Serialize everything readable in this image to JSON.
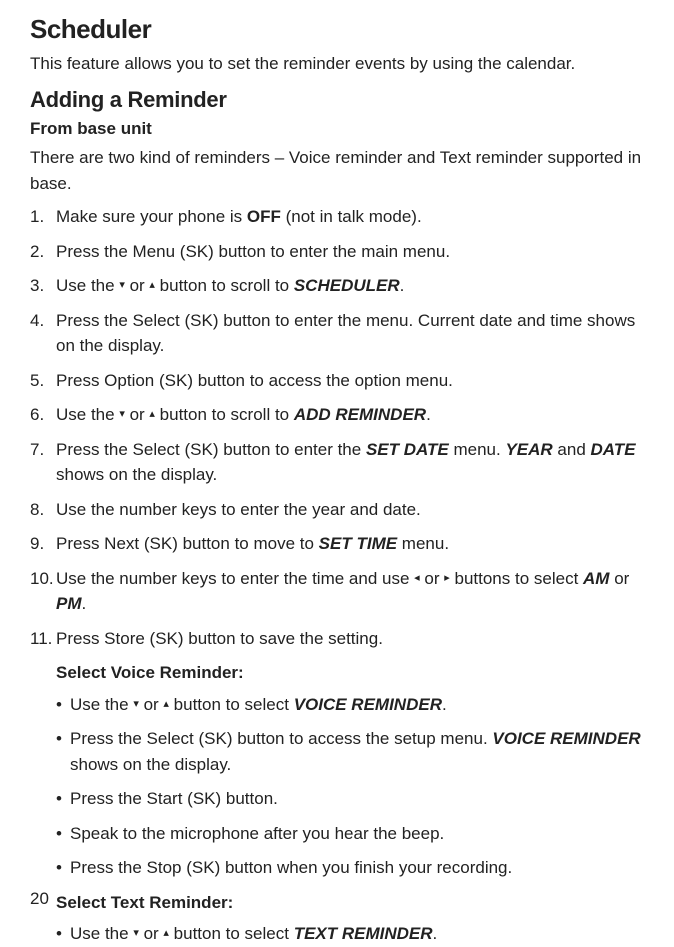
{
  "title": "Scheduler",
  "intro": "This feature allows you to set the reminder events by using the calendar.",
  "section_title": "Adding a Reminder",
  "sub_title": "From base unit",
  "para1": "There are two kind of reminders – Voice reminder and Text reminder supported in base.",
  "steps": {
    "s1_a": "Make sure your phone is ",
    "s1_off": "OFF",
    "s1_b": " (not in talk mode).",
    "s2": "Press the Menu (SK) button to enter the main menu.",
    "s3_a": "Use the ",
    "s3_b": " or ",
    "s3_c": " button to scroll to ",
    "s3_sched": "SCHEDULER",
    "s3_d": ".",
    "s4": "Press the Select (SK) button to enter the menu. Current date and time shows on the display.",
    "s5": "Press Option (SK) button to access the option menu.",
    "s6_a": "Use the ",
    "s6_b": " or ",
    "s6_c": " button to scroll to ",
    "s6_add": "ADD REMINDER",
    "s6_d": ".",
    "s7_a": "Press the Select (SK) button to enter the ",
    "s7_setdate": "SET DATE",
    "s7_b": " menu. ",
    "s7_year": "YEAR",
    "s7_c": " and ",
    "s7_date": "DATE",
    "s7_d": " shows on the display.",
    "s8": "Use the number keys to enter the year and date.",
    "s9_a": "Press Next (SK) button to move to ",
    "s9_settime": "SET TIME",
    "s9_b": " menu.",
    "s10_a": "Use the number keys to enter the time and use ",
    "s10_b": " or ",
    "s10_c": " buttons to select ",
    "s10_am": "AM",
    "s10_d": " or ",
    "s10_pm": "PM",
    "s10_e": ".",
    "s11": "Press Store (SK) button to save the setting."
  },
  "voice_heading": "Select Voice Reminder:",
  "voice": {
    "v1_a": "Use the ",
    "v1_b": " or ",
    "v1_c": " button to select ",
    "v1_vr": "VOICE REMINDER",
    "v1_d": ".",
    "v2_a": "Press the Select (SK) button to access the setup menu. ",
    "v2_vr": "VOICE REMINDER",
    "v2_b": " shows on the display.",
    "v3": "Press the Start (SK) button.",
    "v4": "Speak to the microphone after you hear the beep.",
    "v5": "Press the Stop (SK) button when you finish your recording."
  },
  "text_heading": "Select Text Reminder:",
  "text": {
    "t1_a": "Use the ",
    "t1_b": " or ",
    "t1_c": " button to select ",
    "t1_tr": "TEXT REMINDER",
    "t1_d": "."
  },
  "icons": {
    "down": "▾",
    "up": "▴",
    "left": "◂",
    "right": "▸"
  },
  "page_number": "20"
}
